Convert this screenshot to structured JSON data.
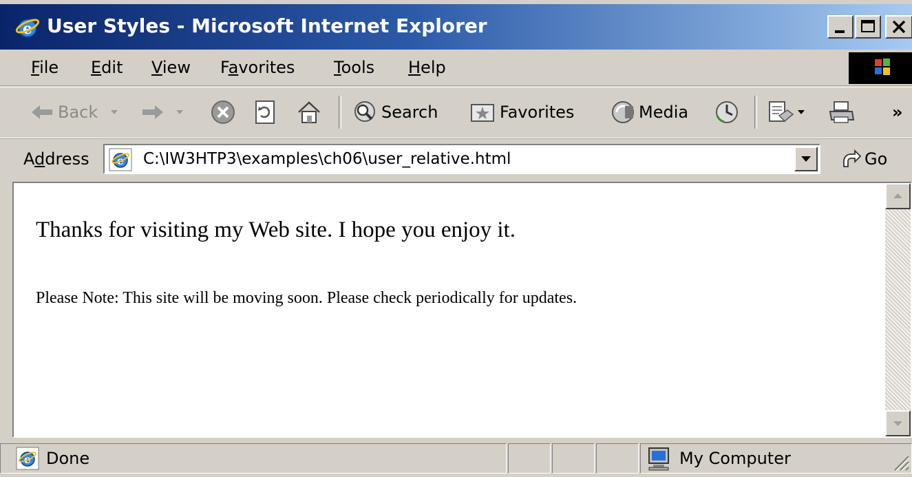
{
  "window": {
    "title": "User Styles - Microsoft Internet Explorer",
    "minimize_icon": "minimize-icon",
    "maximize_icon": "maximize-icon",
    "close_icon": "close-icon"
  },
  "menu": {
    "items": [
      {
        "prefix": "",
        "accel": "F",
        "rest": "ile"
      },
      {
        "prefix": "",
        "accel": "E",
        "rest": "dit"
      },
      {
        "prefix": "",
        "accel": "V",
        "rest": "iew"
      },
      {
        "prefix": "F",
        "accel": "a",
        "rest": "vorites"
      },
      {
        "prefix": "",
        "accel": "T",
        "rest": "ools"
      },
      {
        "prefix": "",
        "accel": "H",
        "rest": "elp"
      }
    ]
  },
  "toolbar": {
    "back_label": "Back",
    "search_label": "Search",
    "favorites_label": "Favorites",
    "media_label": "Media",
    "chevron": "»"
  },
  "address": {
    "label_pre": "A",
    "label_accel": "d",
    "label_post": "dress",
    "url": "C:\\IW3HTP3\\examples\\ch06\\user_relative.html",
    "go_label": "Go"
  },
  "content": {
    "paragraph1": "Thanks for visiting my Web site. I hope you enjoy it.",
    "paragraph2": "Please Note: This site will be moving soon. Please check periodically for updates."
  },
  "status": {
    "text": "Done",
    "zone": "My Computer"
  },
  "colors": {
    "titlebar_start": "#0a246a",
    "titlebar_end": "#a6caf0",
    "chrome": "#d4d0c8"
  }
}
